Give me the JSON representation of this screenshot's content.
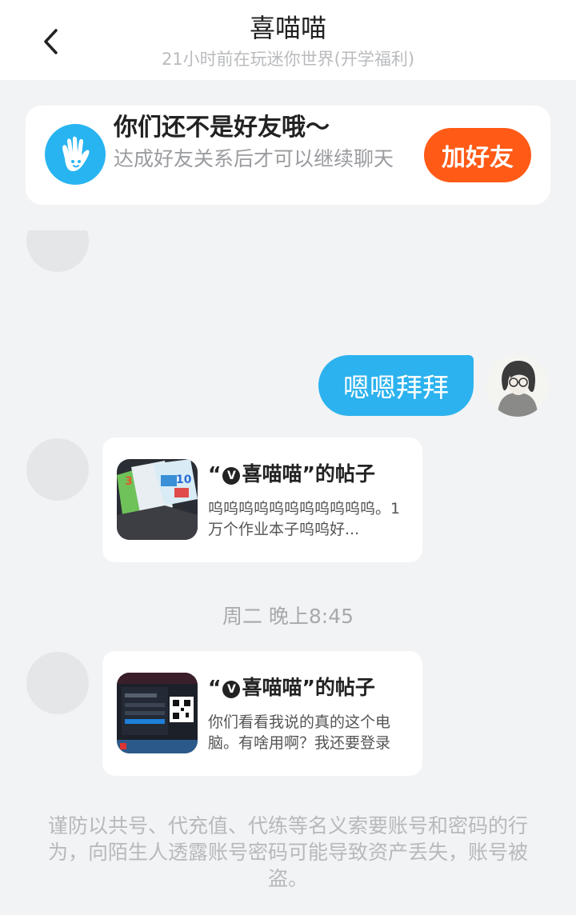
{
  "header": {
    "title": "喜喵喵",
    "subtitle": "21小时前在玩迷你世界(开学福利)",
    "back_icon": "chevron-left-icon"
  },
  "friend_notice": {
    "title": "你们还不是好友哦～",
    "description": "达成好友关系后才可以继续聊天",
    "add_button_label": "加好友",
    "icon": "hand-wave-icon",
    "accent_color": "#ff5a16",
    "icon_color": "#28b4f0"
  },
  "messages": {
    "outgoing": {
      "text": "嗯嗯拜拜",
      "bubble_color": "#2cb2ee"
    },
    "posts": [
      {
        "title_prefix": "“",
        "badge": "V",
        "author": "喜喵喵",
        "title_suffix": "”的帖子",
        "description": "呜呜呜呜呜呜呜呜呜呜呜。1万个作业本子呜呜好..."
      },
      {
        "title_prefix": "“",
        "badge": "V",
        "author": "喜喵喵",
        "title_suffix": "”的帖子",
        "description": "你们看看我说的真的这个电脑。有啥用啊？我还要登录"
      }
    ],
    "timestamp": "周二 晚上8:45"
  },
  "warning": {
    "text": "谨防以共号、代充值、代练等名义索要账号和密码的行为，向陌生人透露账号密码可能导致资产丢失，账号被盗。"
  }
}
